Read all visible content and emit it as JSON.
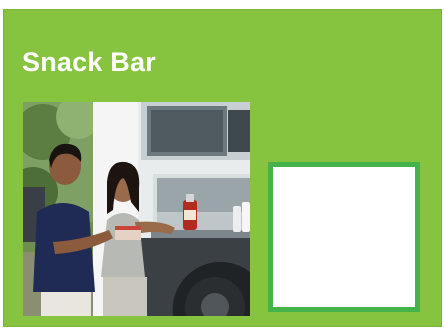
{
  "header": {
    "title": "Snack Bar"
  },
  "photo": {
    "icon": "snack-bar-photo"
  },
  "colors": {
    "panel": "#86c440",
    "panel_border": "#78b535",
    "box_border": "#44b349",
    "title_text": "#ffffff"
  }
}
